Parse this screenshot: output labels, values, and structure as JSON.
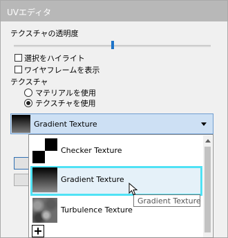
{
  "window": {
    "title": "UVエディタ"
  },
  "opacity": {
    "label": "テクスチャの透明度",
    "value": 0.5
  },
  "checkboxes": [
    {
      "label": "選択をハイライト",
      "checked": false
    },
    {
      "label": "ワイヤフレームを表示",
      "checked": false
    }
  ],
  "texture_group": {
    "label": "テクスチャ",
    "options": [
      {
        "label": "マテリアルを使用",
        "selected": false
      },
      {
        "label": "テクスチャを使用",
        "selected": true
      }
    ]
  },
  "combo": {
    "selected_label": "Gradient Texture",
    "thumb_icon": "gradient-thumbnail"
  },
  "dropdown": {
    "items": [
      {
        "label": "Checker Texture",
        "icon": "checker-thumbnail"
      },
      {
        "label": "Gradient Texture",
        "icon": "gradient-thumbnail",
        "highlighted": true
      },
      {
        "label": "Turbulence Texture",
        "icon": "turbulence-thumbnail"
      }
    ],
    "add_icon": "plus-icon"
  },
  "tooltip": {
    "text": "Gradient Texture"
  },
  "colors": {
    "highlight_border": "#4fe2f5",
    "combo_bg": "#cde0f4",
    "title_bar": "#b8b8b8"
  }
}
